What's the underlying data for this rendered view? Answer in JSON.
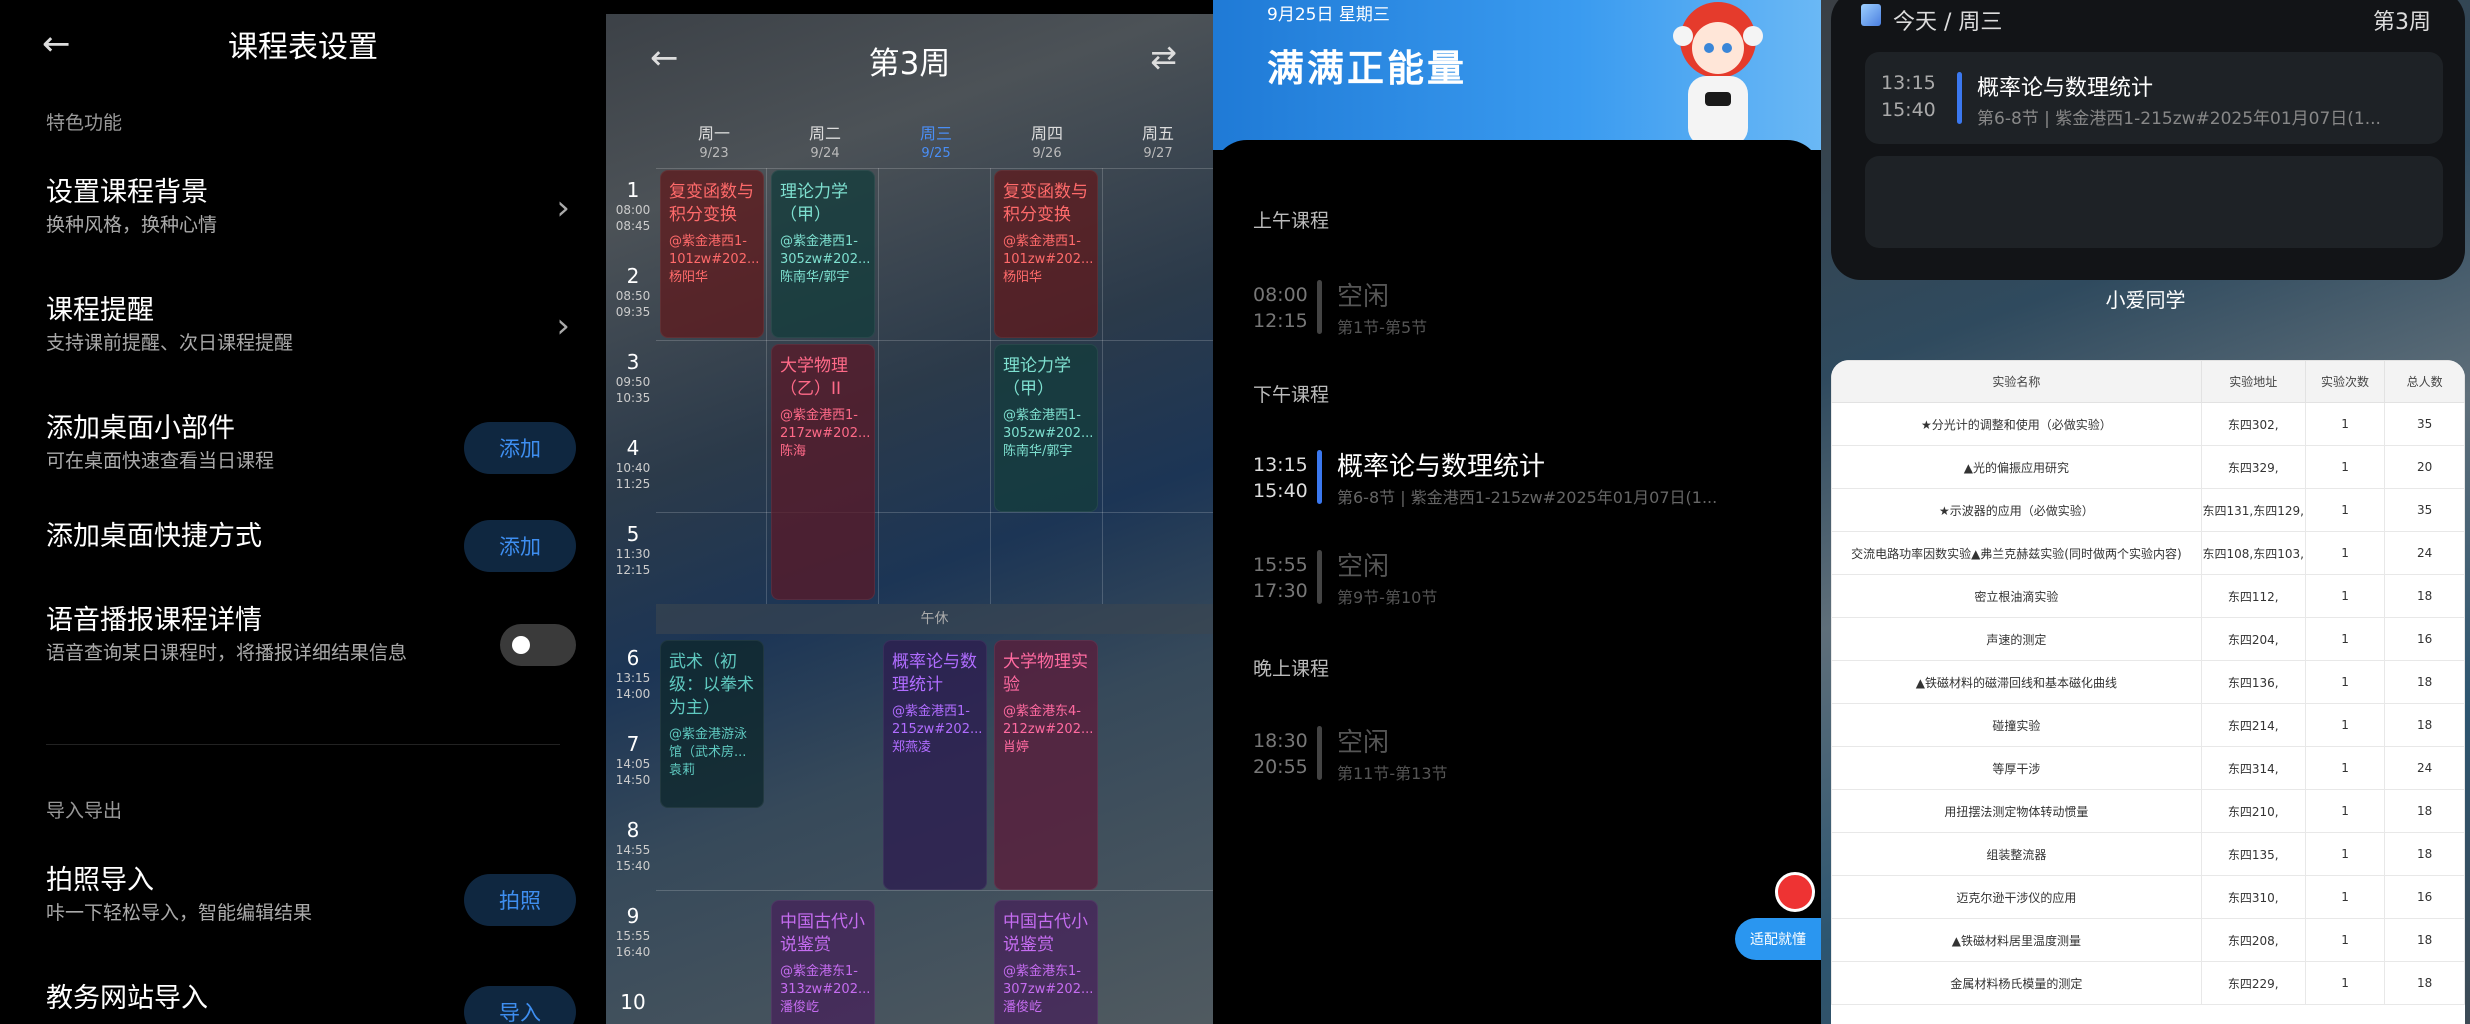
{
  "settings": {
    "title": "课程表设置",
    "section_features": "特色功能",
    "items": [
      {
        "title": "设置课程背景",
        "subtitle": "换种风格，换种心情"
      },
      {
        "title": "课程提醒",
        "subtitle": "支持课前提醒、次日课程提醒"
      },
      {
        "title": "添加桌面小部件",
        "subtitle": "可在桌面快速查看当日课程",
        "button": "添加"
      },
      {
        "title": "添加桌面快捷方式",
        "button": "添加"
      },
      {
        "title": "语音播报课程详情",
        "subtitle": "语音查询某日课程时，将播报详细结果信息"
      }
    ],
    "section_import": "导入导出",
    "import_items": [
      {
        "title": "拍照导入",
        "subtitle": "咔一下轻松导入，智能编辑结果",
        "button": "拍照"
      },
      {
        "title": "教务网站导入",
        "button": "导入"
      }
    ]
  },
  "schedule": {
    "title": "第3周",
    "days": [
      {
        "name": "周一",
        "date": "9/23"
      },
      {
        "name": "周二",
        "date": "9/24"
      },
      {
        "name": "周三",
        "date": "9/25"
      },
      {
        "name": "周四",
        "date": "9/26"
      },
      {
        "name": "周五",
        "date": "9/27"
      }
    ],
    "periods": [
      {
        "n": "1",
        "start": "08:00",
        "end": "08:45"
      },
      {
        "n": "2",
        "start": "08:50",
        "end": "09:35"
      },
      {
        "n": "3",
        "start": "09:50",
        "end": "10:35"
      },
      {
        "n": "4",
        "start": "10:40",
        "end": "11:25"
      },
      {
        "n": "5",
        "start": "11:30",
        "end": "12:15"
      },
      {
        "n": "6",
        "start": "13:15",
        "end": "14:00"
      },
      {
        "n": "7",
        "start": "14:05",
        "end": "14:50"
      },
      {
        "n": "8",
        "start": "14:55",
        "end": "15:40"
      },
      {
        "n": "9",
        "start": "15:55",
        "end": "16:40"
      },
      {
        "n": "10",
        "start": "",
        "end": ""
      }
    ],
    "noon_label": "午休",
    "courses": [
      {
        "name": "复变函数与积分变换",
        "loc": "@紫金港西1-101zw#202...",
        "teacher": "杨阳华"
      },
      {
        "name": "理论力学（甲）",
        "loc": "@紫金港西1-305zw#202...",
        "teacher": "陈南华/郭宇"
      },
      {
        "name": "复变函数与积分变换",
        "loc": "@紫金港西1-101zw#202...",
        "teacher": "杨阳华"
      },
      {
        "name": "大学物理（乙）II",
        "loc": "@紫金港西1-217zw#202...",
        "teacher": "陈海"
      },
      {
        "name": "理论力学（甲）",
        "loc": "@紫金港西1-305zw#202...",
        "teacher": "陈南华/郭宇"
      },
      {
        "name": "武术（初级：以拳术为主）",
        "loc": "@紫金港游泳馆（武术房...",
        "teacher": "袁莉"
      },
      {
        "name": "概率论与数理统计",
        "loc": "@紫金港西1-215zw#202...",
        "teacher": "郑燕凌"
      },
      {
        "name": "大学物理实验",
        "loc": "@紫金港东4-212zw#202...",
        "teacher": "肖婷"
      },
      {
        "name": "中国古代小说鉴赏",
        "loc": "@紫金港东1-313zw#202...",
        "teacher": "潘俊屹"
      },
      {
        "name": "中国古代小说鉴赏",
        "loc": "@紫金港东1-307zw#202...",
        "teacher": "潘俊屹"
      }
    ]
  },
  "widget_dark": {
    "date": "9月25日 星期三",
    "slogan": "满满正能量",
    "sections": {
      "morning": "上午课程",
      "afternoon": "下午课程",
      "evening": "晚上课程"
    },
    "items": [
      {
        "start": "08:00",
        "end": "12:15",
        "name": "空闲",
        "desc": "第1节-第5节"
      },
      {
        "start": "13:15",
        "end": "15:40",
        "name": "概率论与数理统计",
        "desc": "第6-8节 | 紫金港西1-215zw#2025年01月07日(1..."
      },
      {
        "start": "15:55",
        "end": "17:30",
        "name": "空闲",
        "desc": "第9节-第10节"
      },
      {
        "start": "18:30",
        "end": "20:55",
        "name": "空闲",
        "desc": "第11节-第13节"
      }
    ],
    "float_button": "适配就懂"
  },
  "widget_light": {
    "today": "今天 / 周三",
    "week": "第3周",
    "course": {
      "start": "13:15",
      "end": "15:40",
      "name": "概率论与数理统计",
      "desc": "第6-8节 | 紫金港西1-215zw#2025年01月07日(1..."
    },
    "label": "小爱同学"
  },
  "lab_table": {
    "headers": [
      "实验名称",
      "实验地址",
      "实验次数",
      "总人数"
    ],
    "rows": [
      [
        "★分光计的调整和使用（必做实验）",
        "东四302,",
        "1",
        "35"
      ],
      [
        "▲光的偏振应用研究",
        "东四329,",
        "1",
        "20"
      ],
      [
        "★示波器的应用（必做实验）",
        "东四131,东四129,",
        "1",
        "35"
      ],
      [
        "交流电路功率因数实验▲弗兰克赫兹实验(同时做两个实验内容)",
        "东四108,东四103,",
        "1",
        "24"
      ],
      [
        "密立根油滴实验",
        "东四112,",
        "1",
        "18"
      ],
      [
        "声速的测定",
        "东四204,",
        "1",
        "16"
      ],
      [
        "▲铁磁材料的磁滞回线和基本磁化曲线",
        "东四136,",
        "1",
        "18"
      ],
      [
        "碰撞实验",
        "东四214,",
        "1",
        "18"
      ],
      [
        "等厚干涉",
        "东四314,",
        "1",
        "24"
      ],
      [
        "用扭摆法测定物体转动惯量",
        "东四210,",
        "1",
        "18"
      ],
      [
        "组装整流器",
        "东四135,",
        "1",
        "18"
      ],
      [
        "迈克尔逊干涉仪的应用",
        "东四310,",
        "1",
        "16"
      ],
      [
        "▲铁磁材料居里温度测量",
        "东四208,",
        "1",
        "18"
      ],
      [
        "金属材料杨氏模量的测定",
        "东四229,",
        "1",
        "18"
      ]
    ]
  }
}
